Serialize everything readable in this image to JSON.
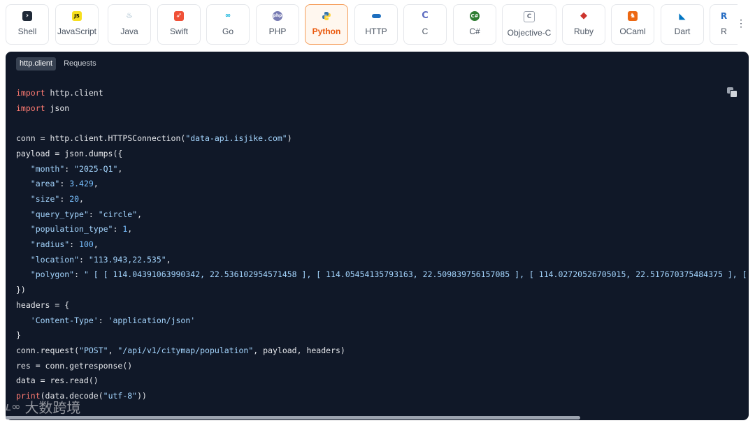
{
  "languages": [
    {
      "label": "Shell",
      "icon": "terminal-icon",
      "color": "#1f2937",
      "glyph": "›"
    },
    {
      "label": "JavaScript",
      "icon": "javascript-icon",
      "color": "#f7df1e",
      "glyph": "JS"
    },
    {
      "label": "Java",
      "icon": "java-icon",
      "color": "#5382a1",
      "glyph": "♨"
    },
    {
      "label": "Swift",
      "icon": "swift-icon",
      "color": "#f05138",
      "glyph": "➶"
    },
    {
      "label": "Go",
      "icon": "go-icon",
      "color": "#00add8",
      "glyph": "∞"
    },
    {
      "label": "PHP",
      "icon": "php-icon",
      "color": "#777bb3",
      "glyph": "●"
    },
    {
      "label": "Python",
      "icon": "python-icon",
      "color": "#3776ab",
      "glyph": "🐍",
      "active": true
    },
    {
      "label": "HTTP",
      "icon": "http-icon",
      "color": "#1e6fbf",
      "glyph": "▬"
    },
    {
      "label": "C",
      "icon": "c-icon",
      "color": "#5c6bc0",
      "glyph": "C"
    },
    {
      "label": "C#",
      "icon": "csharp-icon",
      "color": "#2e7d32",
      "glyph": "◎"
    },
    {
      "label": "Objective-C",
      "icon": "objective-c-icon",
      "color": "#9ca3af",
      "glyph": "C"
    },
    {
      "label": "Ruby",
      "icon": "ruby-icon",
      "color": "#cc342d",
      "glyph": "◆"
    },
    {
      "label": "OCaml",
      "icon": "ocaml-icon",
      "color": "#ec6813",
      "glyph": "♞"
    },
    {
      "label": "Dart",
      "icon": "dart-icon",
      "color": "#0175c2",
      "glyph": "◣"
    },
    {
      "label": "R",
      "icon": "r-icon",
      "color": "#276dc3",
      "glyph": "R"
    }
  ],
  "sub_tabs": [
    "http.client",
    "Requests"
  ],
  "watermark": "大数跨境"
}
